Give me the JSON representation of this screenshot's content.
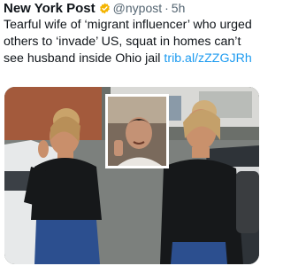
{
  "tweet": {
    "author_name": "New York Post",
    "handle": "@nypost",
    "separator": "·",
    "age": "5h",
    "text": "Tearful wife of ‘migrant influencer’ who urged others to ‘invade’ US, squat in homes can’t see husband inside Ohio jail ",
    "link_text": "trib.al/zZZGJRh",
    "verified_color": "#f4b400",
    "link_color": "#1d9bf0"
  },
  "media": {
    "photos": [
      "woman-left-photo",
      "inset-selfie-photo",
      "woman-right-photo"
    ]
  }
}
